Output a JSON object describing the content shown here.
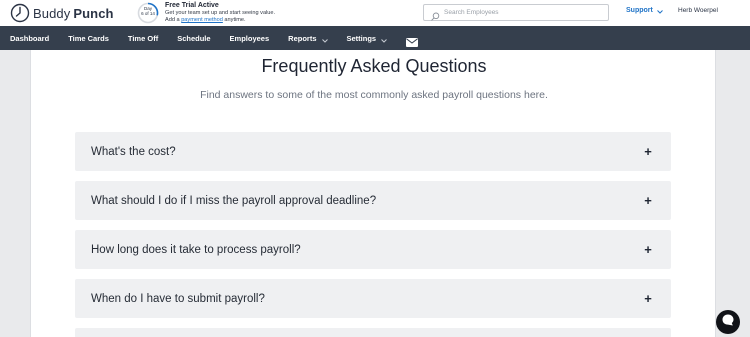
{
  "header": {
    "logo_text_light": "Buddy",
    "logo_text_bold": "Punch",
    "trial": {
      "ring_line1": "Day",
      "ring_line2": "6 of 14",
      "title": "Free Trial Active",
      "line1": "Get your team set up and start seeing value.",
      "line2_prefix": "Add a",
      "line2_link": "payment method",
      "line2_suffix": "anytime."
    },
    "search": {
      "placeholder": "Search Employees",
      "value": ""
    },
    "support_label": "Support",
    "user_name": "Herb Woerpel"
  },
  "nav": {
    "items": [
      {
        "label": "Dashboard",
        "dropdown": false
      },
      {
        "label": "Time Cards",
        "dropdown": false
      },
      {
        "label": "Time Off",
        "dropdown": false
      },
      {
        "label": "Schedule",
        "dropdown": false
      },
      {
        "label": "Employees",
        "dropdown": false
      },
      {
        "label": "Reports",
        "dropdown": true
      },
      {
        "label": "Settings",
        "dropdown": true
      }
    ],
    "mail_icon": "envelope-icon"
  },
  "main": {
    "title": "Frequently Asked Questions",
    "subtitle": "Find answers to some of the most commonly asked payroll questions here.",
    "faqs": [
      {
        "question": "What's the cost?"
      },
      {
        "question": "What should I do if I miss the payroll approval deadline?"
      },
      {
        "question": "How long does it take to process payroll?"
      },
      {
        "question": "When do I have to submit payroll?"
      }
    ],
    "expand_icon": "plus-icon"
  },
  "colors": {
    "navbar": "#353f4d",
    "link": "#1f73c7",
    "faq_bg": "#eff0f2",
    "page_bg": "#e9eaec"
  }
}
